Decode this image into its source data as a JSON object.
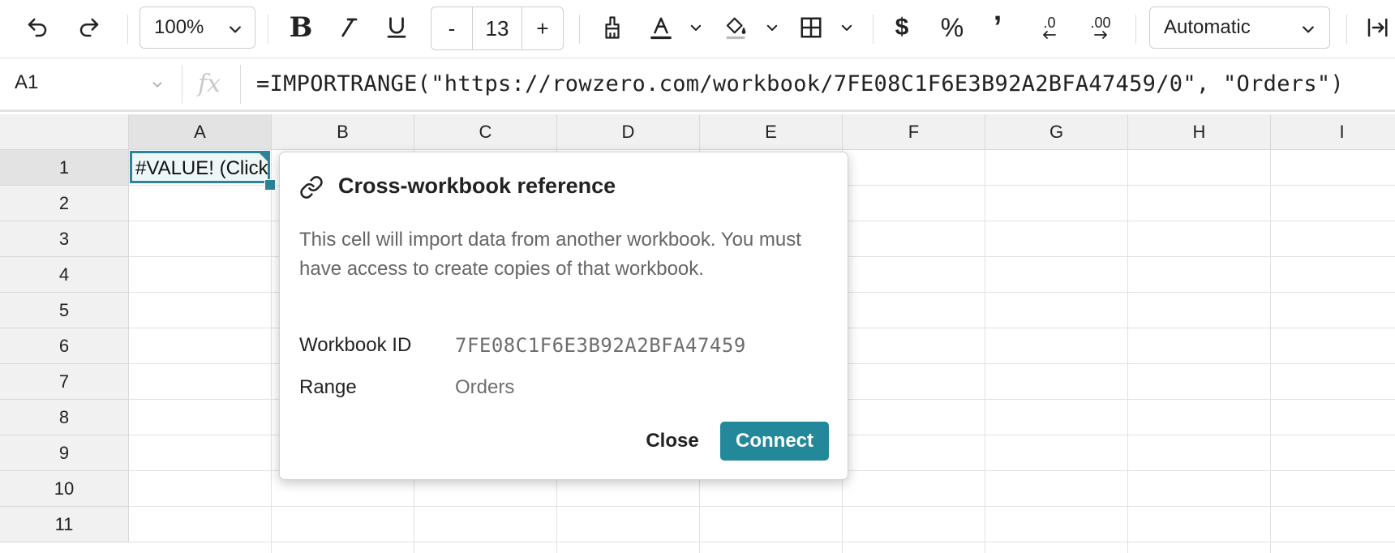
{
  "toolbar": {
    "zoom": "100%",
    "font_size": "13",
    "decrease_label": "-",
    "increase_label": "+",
    "bold_label": "B",
    "currency_label": "$",
    "percent_label": "%",
    "comma_label": "’",
    "decrease_decimals_label": ".0",
    "increase_decimals_label": ".00",
    "number_format": "Automatic",
    "icons": [
      "undo-icon",
      "redo-icon",
      "italic-icon",
      "underline-icon",
      "paint-format-icon",
      "text-color-icon",
      "fill-color-icon",
      "borders-icon",
      "wrap-icon"
    ]
  },
  "formula_bar": {
    "cell_ref": "A1",
    "fx_label": "fx",
    "formula": "=IMPORTRANGE(\"https://rowzero.com/workbook/7FE08C1F6E3B92A2BFA47459/0\", \"Orders\")"
  },
  "grid": {
    "columns": [
      "A",
      "B",
      "C",
      "D",
      "E",
      "F",
      "G",
      "H",
      "I"
    ],
    "rows": [
      "1",
      "2",
      "3",
      "4",
      "5",
      "6",
      "7",
      "8",
      "9",
      "10",
      "11"
    ],
    "active_cell_value": "#VALUE! (Click",
    "accent_color": "#2e8496"
  },
  "dialog": {
    "title": "Cross-workbook reference",
    "description": "This cell will import data from another workbook. You must have access to create copies of that workbook.",
    "workbook_id_label": "Workbook ID",
    "workbook_id_value": "7FE08C1F6E3B92A2BFA47459",
    "range_label": "Range",
    "range_value": "Orders",
    "close_label": "Close",
    "connect_label": "Connect",
    "connect_color": "#23889a"
  }
}
